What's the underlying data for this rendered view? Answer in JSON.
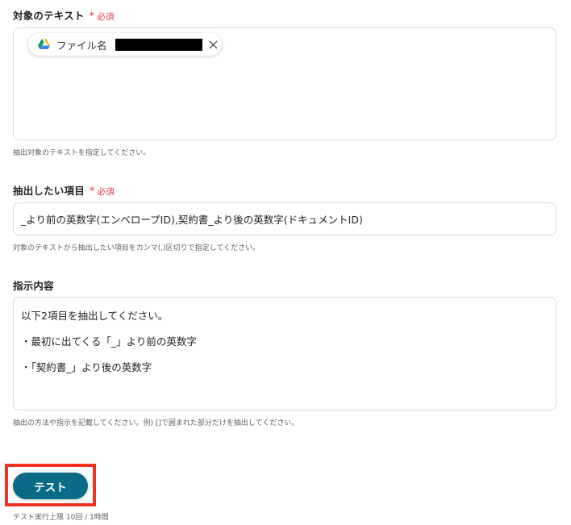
{
  "fields": [
    {
      "label": "対象のテキスト",
      "required_mark": "必須",
      "chip_label": "ファイル名",
      "help": "抽出対象のテキストを指定してください。"
    },
    {
      "label": "抽出したい項目",
      "required_mark": "必須",
      "value": "_より前の英数字(エンベロープID),契約書_より後の英数字(ドキュメントID)",
      "help": "対象のテキストから抽出したい項目をカンマ(,)区切りで指定してください。"
    },
    {
      "label": "指示内容",
      "lines": [
        "以下2項目を抽出してください。",
        "・最初に出てくる「_」より前の英数字",
        "・「契約書_」より後の英数字"
      ],
      "help": "抽出の方法や指示を記載してください。例) []で囲まれた部分だけを抽出してください。"
    }
  ],
  "test_button": {
    "label": "テスト",
    "note": "テスト実行上限 10回 / 1時間"
  },
  "colors": {
    "required": "#e8343f",
    "button": "#0b6b86",
    "highlight": "#f4311e"
  },
  "icons": {
    "chip": "google-drive-icon",
    "close": "close-icon",
    "asterisk": "asterisk-icon"
  }
}
